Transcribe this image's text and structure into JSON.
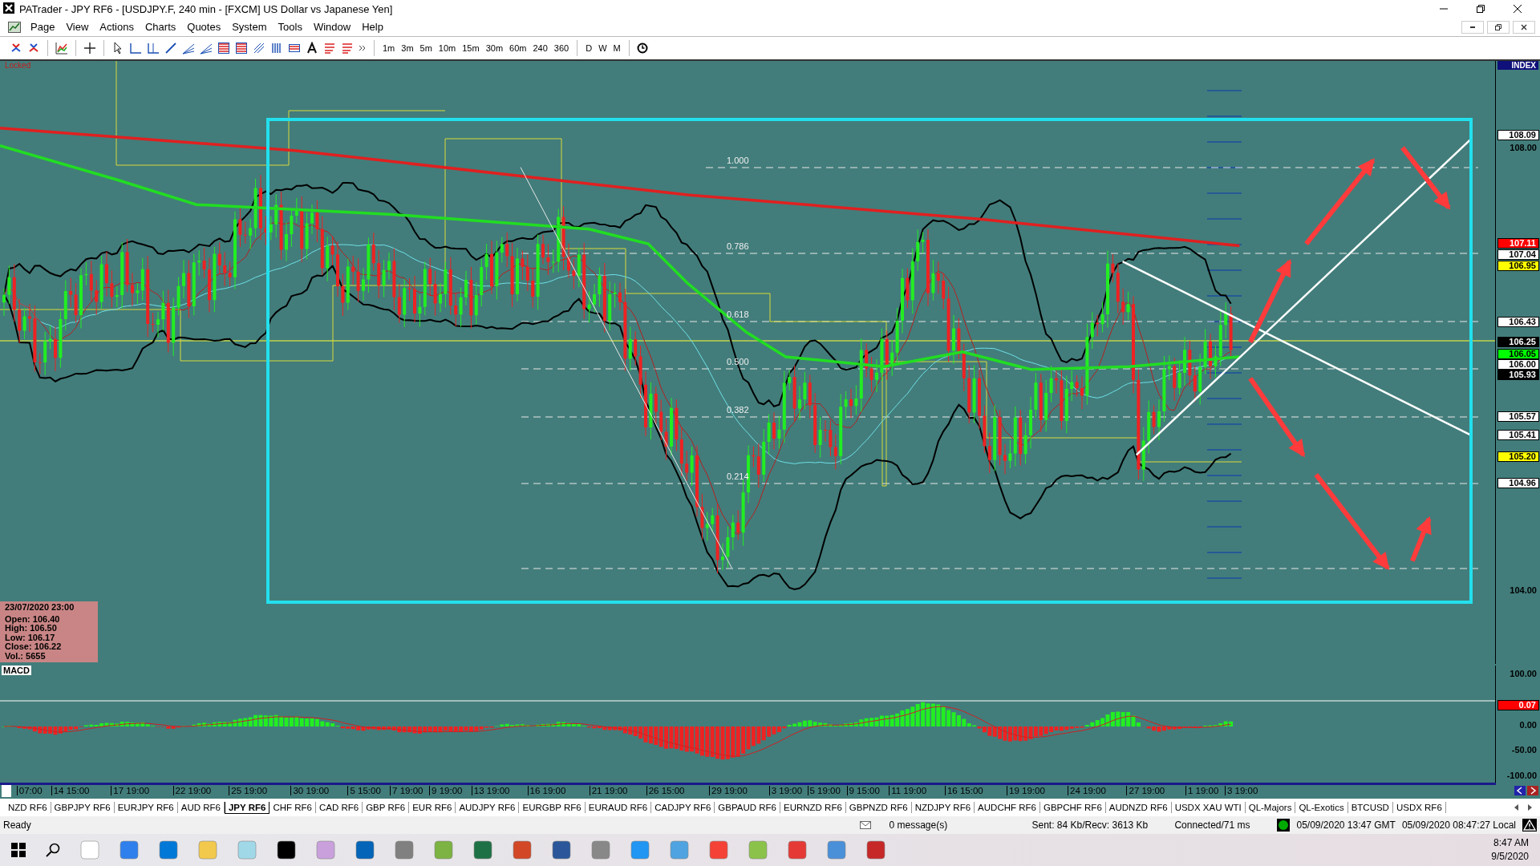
{
  "window": {
    "title": "PATrader - JPY RF6 - [USDJPY.F, 240 min - [FXCM] US Dollar vs Japanese Yen]"
  },
  "menu": [
    "Page",
    "View",
    "Actions",
    "Charts",
    "Quotes",
    "System",
    "Tools",
    "Window",
    "Help"
  ],
  "periods": [
    "1m",
    "3m",
    "5m",
    "10m",
    "15m",
    "30m",
    "60m",
    "240",
    "360"
  ],
  "calendar_periods": [
    "D",
    "W",
    "M"
  ],
  "chart": {
    "lock_label": "Locked",
    "index_label": "INDEX",
    "fib_levels": [
      "1.000",
      "0.786",
      "0.618",
      "0.500",
      "0.382",
      "0.214"
    ],
    "price_labels": [
      {
        "text": "108.09",
        "kind": "boxed",
        "color": "#ffffff"
      },
      {
        "text": "108.00",
        "kind": "plain"
      },
      {
        "text": "107.11",
        "kind": "boxed",
        "color": "#ff0000"
      },
      {
        "text": "107.04",
        "kind": "boxed",
        "color": "#ffffff"
      },
      {
        "text": "106.95",
        "kind": "boxed",
        "color": "#ffff00"
      },
      {
        "text": "106.43",
        "kind": "boxed",
        "color": "#ffffff"
      },
      {
        "text": "106.25",
        "kind": "boxed",
        "color": "#000000"
      },
      {
        "text": "106.05",
        "kind": "boxed",
        "color": "#00ff00"
      },
      {
        "text": "106.00",
        "kind": "boxed",
        "color": "#ffffff"
      },
      {
        "text": "105.93",
        "kind": "boxed",
        "color": "#000000"
      },
      {
        "text": "105.57",
        "kind": "boxed",
        "color": "#ffffff"
      },
      {
        "text": "105.41",
        "kind": "boxed",
        "color": "#ffffff"
      },
      {
        "text": "105.20",
        "kind": "boxed",
        "color": "#ffff00"
      },
      {
        "text": "104.96",
        "kind": "boxed",
        "color": "#ffffff"
      },
      {
        "text": "104.00",
        "kind": "plain"
      }
    ],
    "info_box": {
      "date": "23/07/2020 23:00",
      "lines": [
        "Open: 106.40",
        "High: 106.50",
        "Low: 106.17",
        "Close: 106.22",
        "Vol.: 5655"
      ]
    }
  },
  "macd": {
    "label": "MACD",
    "axis_labels": [
      {
        "text": "100.00",
        "kind": "plain"
      },
      {
        "text": "0.07",
        "kind": "boxed",
        "color": "#ff0000"
      },
      {
        "text": "0.00",
        "kind": "plain"
      },
      {
        "text": "-50.00",
        "kind": "plain"
      },
      {
        "text": "-100.00",
        "kind": "plain"
      }
    ]
  },
  "time_axis": [
    "07:00",
    "14 15:00",
    "17 19:00",
    "22 19:00",
    "25 19:00",
    "30 19:00",
    "5 15:00",
    "7 19:00",
    "9 19:00",
    "13 19:00",
    "16 19:00",
    "21 19:00",
    "26 15:00",
    "29 19:00",
    "3 19:00",
    "5 19:00",
    "9 15:00",
    "11 19:00",
    "16 15:00",
    "19 19:00",
    "24 19:00",
    "27 19:00",
    "1 19:00",
    "3 19:00"
  ],
  "symbol_tabs": [
    {
      "label": "NZD RF6",
      "selected": false
    },
    {
      "label": "GBPJPY RF6",
      "selected": false
    },
    {
      "label": "EURJPY RF6",
      "selected": false
    },
    {
      "label": "AUD RF6",
      "selected": false
    },
    {
      "label": "JPY RF6",
      "selected": true
    },
    {
      "label": "CHF RF6",
      "selected": false
    },
    {
      "label": "CAD RF6",
      "selected": false
    },
    {
      "label": "GBP RF6",
      "selected": false
    },
    {
      "label": "EUR RF6",
      "selected": false
    },
    {
      "label": "AUDJPY RF6",
      "selected": false
    },
    {
      "label": "EURGBP RF6",
      "selected": false
    },
    {
      "label": "EURAUD RF6",
      "selected": false
    },
    {
      "label": "CADJPY RF6",
      "selected": false
    },
    {
      "label": "GBPAUD RF6",
      "selected": false
    },
    {
      "label": "EURNZD RF6",
      "selected": false
    },
    {
      "label": "GBPNZD RF6",
      "selected": false
    },
    {
      "label": "NZDJPY RF6",
      "selected": false
    },
    {
      "label": "AUDCHF RF6",
      "selected": false
    },
    {
      "label": "GBPCHF RF6",
      "selected": false
    },
    {
      "label": "AUDNZD RF6",
      "selected": false
    },
    {
      "label": "USDX XAU WTI",
      "selected": false
    },
    {
      "label": "QL-Majors",
      "selected": false
    },
    {
      "label": "QL-Exotics",
      "selected": false
    },
    {
      "label": "BTCUSD",
      "selected": false
    },
    {
      "label": "USDX RF6",
      "selected": false
    }
  ],
  "status_bar": {
    "state": "Ready",
    "messages": "0 message(s)",
    "traffic": "Sent: 84 Kb/Recv: 3613 Kb",
    "connection": "Connected/71 ms",
    "gmt_time": "05/09/2020 13:47 GMT",
    "local_time": "05/09/2020 08:47:27 Local"
  },
  "taskbar": {
    "time": "8:47 AM",
    "date": "9/5/2020"
  }
}
